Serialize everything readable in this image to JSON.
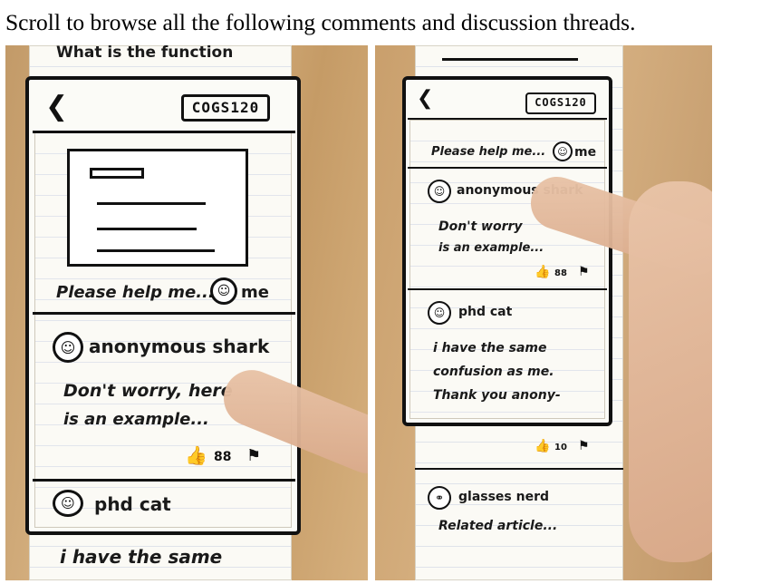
{
  "caption": "Scroll to browse all the following comments and discussion threads.",
  "left": {
    "top_strip_text": "What is the function",
    "course_label": "COGS120",
    "post_footer": "Please help me...",
    "me_label": "me",
    "comment1": {
      "author": "anonymous shark",
      "line1": "Don't worry, here",
      "line2": "is an example...",
      "likes": "88"
    },
    "comment2": {
      "author": "phd cat",
      "line1": "i have the same"
    }
  },
  "right": {
    "course_label": "COGS120",
    "post_footer": "Please help me...",
    "me_label": "me",
    "comment1": {
      "author": "anonymous shark",
      "line1": "Don't worry",
      "line2": "is an example...",
      "likes": "88"
    },
    "comment2": {
      "author": "phd cat",
      "line1": "i have the same",
      "line2": "confusion as me.",
      "line3": "Thank you anony-",
      "likes": "10"
    },
    "comment3": {
      "author": "glasses nerd",
      "line1": "Related article..."
    }
  },
  "icons": {
    "back": "chevron-left-icon",
    "avatar": "user-avatar-icon",
    "like": "thumbs-up-icon",
    "reply": "reply-flag-icon"
  }
}
